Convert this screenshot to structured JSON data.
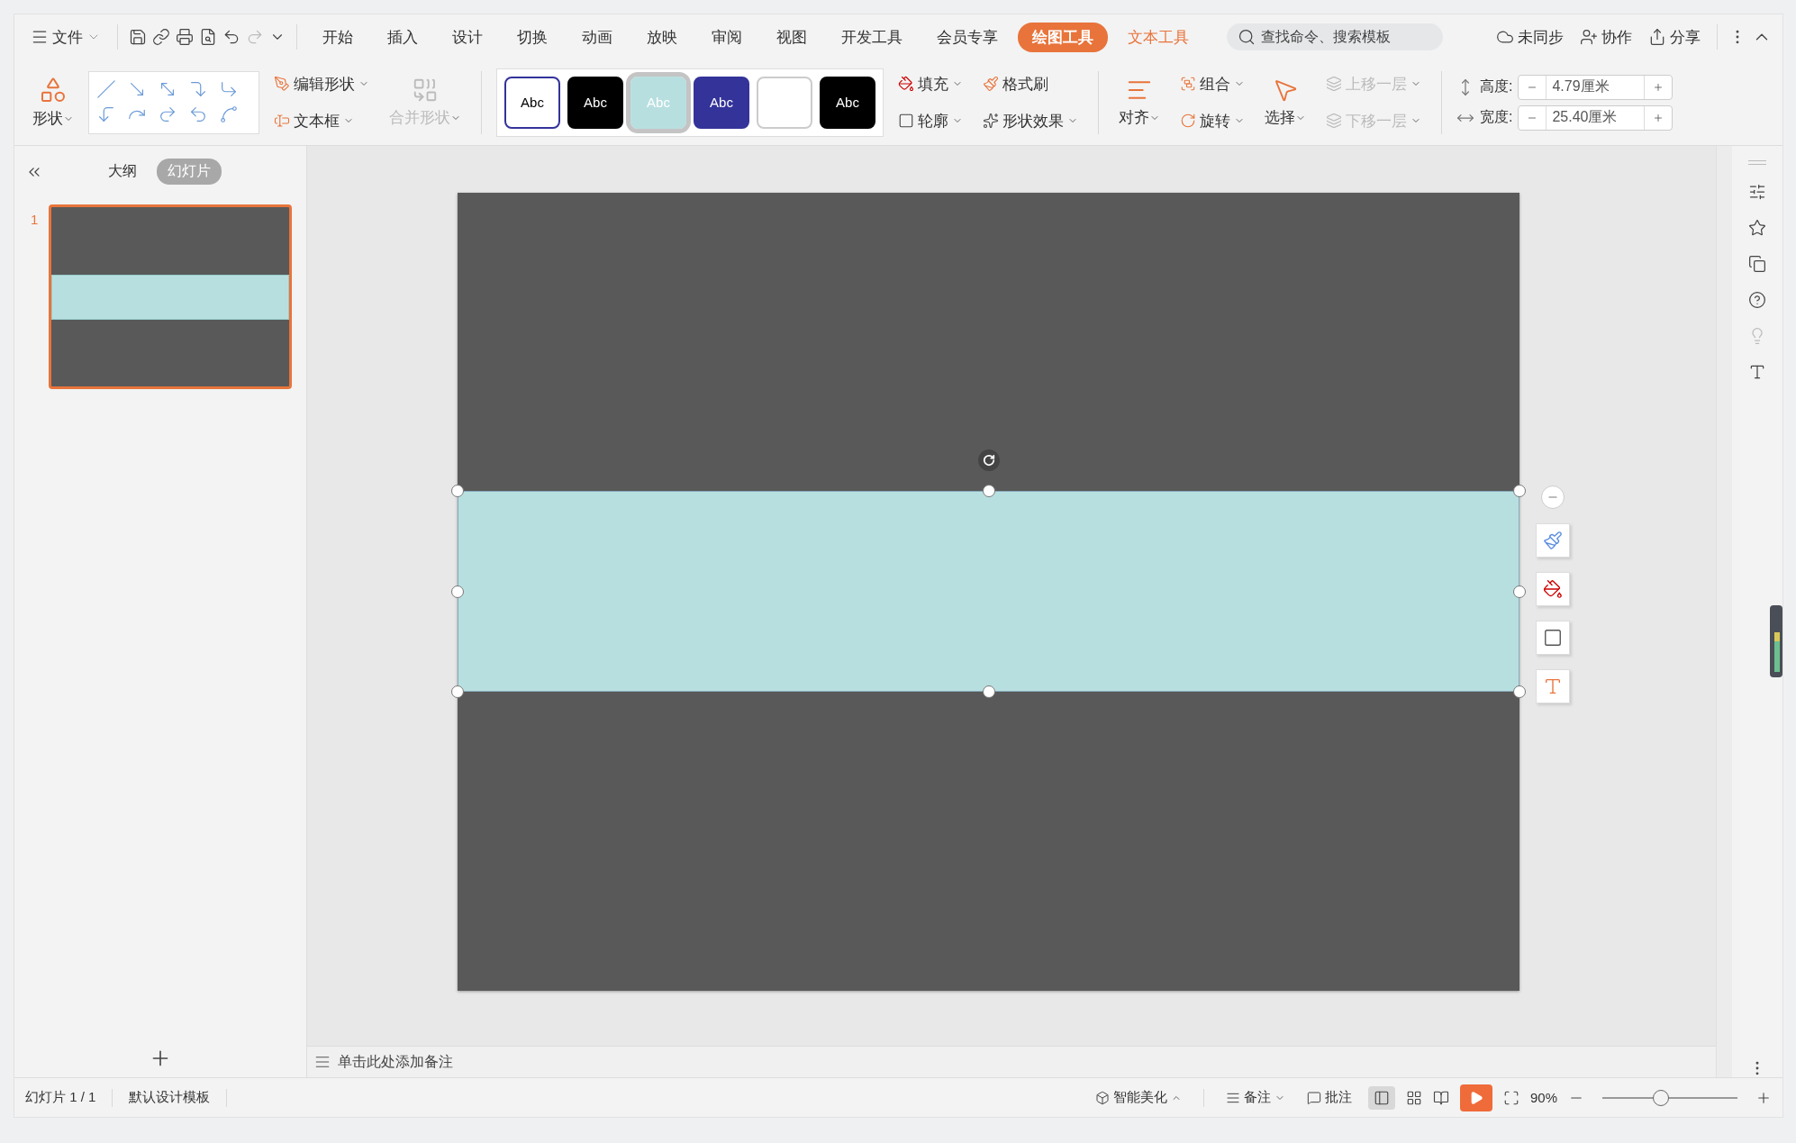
{
  "menu": {
    "file": "文件"
  },
  "ribbon_tabs": [
    {
      "label": "开始",
      "kind": "tab",
      "selected": false
    },
    {
      "label": "插入",
      "kind": "tab",
      "selected": false
    },
    {
      "label": "设计",
      "kind": "tab",
      "selected": false
    },
    {
      "label": "切换",
      "kind": "tab",
      "selected": false
    },
    {
      "label": "动画",
      "kind": "tab",
      "selected": false
    },
    {
      "label": "放映",
      "kind": "tab",
      "selected": false
    },
    {
      "label": "审阅",
      "kind": "tab",
      "selected": false
    },
    {
      "label": "视图",
      "kind": "tab",
      "selected": false
    },
    {
      "label": "开发工具",
      "kind": "tab",
      "selected": false
    },
    {
      "label": "会员专享",
      "kind": "tab",
      "selected": false
    },
    {
      "label": "绘图工具",
      "kind": "contextual",
      "selected": true
    },
    {
      "label": "文本工具",
      "kind": "contextual",
      "selected": false
    }
  ],
  "search": {
    "placeholder": "查找命令、搜索模板"
  },
  "top_actions": [
    "未同步",
    "协作",
    "分享"
  ],
  "ribbon": {
    "shape": "形状",
    "edit_shape": "编辑形状",
    "text_box": "文本框",
    "merge_shapes": {
      "label": "合并形状",
      "disabled": true
    },
    "styles": [
      {
        "text": "Abc",
        "color": "#ffffff",
        "selected": false
      },
      {
        "text": "Abc",
        "color": "#000000",
        "selected": false
      },
      {
        "text": "Abc",
        "color": "#b8dfe0",
        "selected": true
      },
      {
        "text": "Abc",
        "color": "#33339a",
        "selected": false
      },
      {
        "color": "#ffffff",
        "selected": false
      },
      {
        "text": "Abc",
        "color": "#000000",
        "selected": false
      }
    ],
    "fill": "填充",
    "format_painter": "格式刷",
    "outline": "轮廓",
    "shape_effects": "形状效果",
    "align": "对齐",
    "group": "组合",
    "rotate": "旋转",
    "select": "选择",
    "bring_forward": {
      "label": "上移一层",
      "disabled": true
    },
    "send_backward": {
      "label": "下移一层",
      "disabled": true
    },
    "height": {
      "label": "高度:",
      "value": "4.79厘米"
    },
    "width": {
      "label": "宽度:",
      "value": "25.40厘米"
    }
  },
  "sidebar": {
    "tabs": [
      {
        "label": "大纲",
        "selected": false
      },
      {
        "label": "幻灯片",
        "selected": true
      }
    ],
    "slides": [
      {
        "number": "1",
        "selected": true
      }
    ]
  },
  "notes": {
    "placeholder": "单击此处添加备注"
  },
  "status_bar": {
    "slide_count": "幻灯片 1 / 1",
    "template": "默认设计模板",
    "smart": "智能美化",
    "notes": "备注",
    "comments": "批注",
    "zoom": "90%",
    "zoom_slider": {
      "level": 0.43
    }
  }
}
